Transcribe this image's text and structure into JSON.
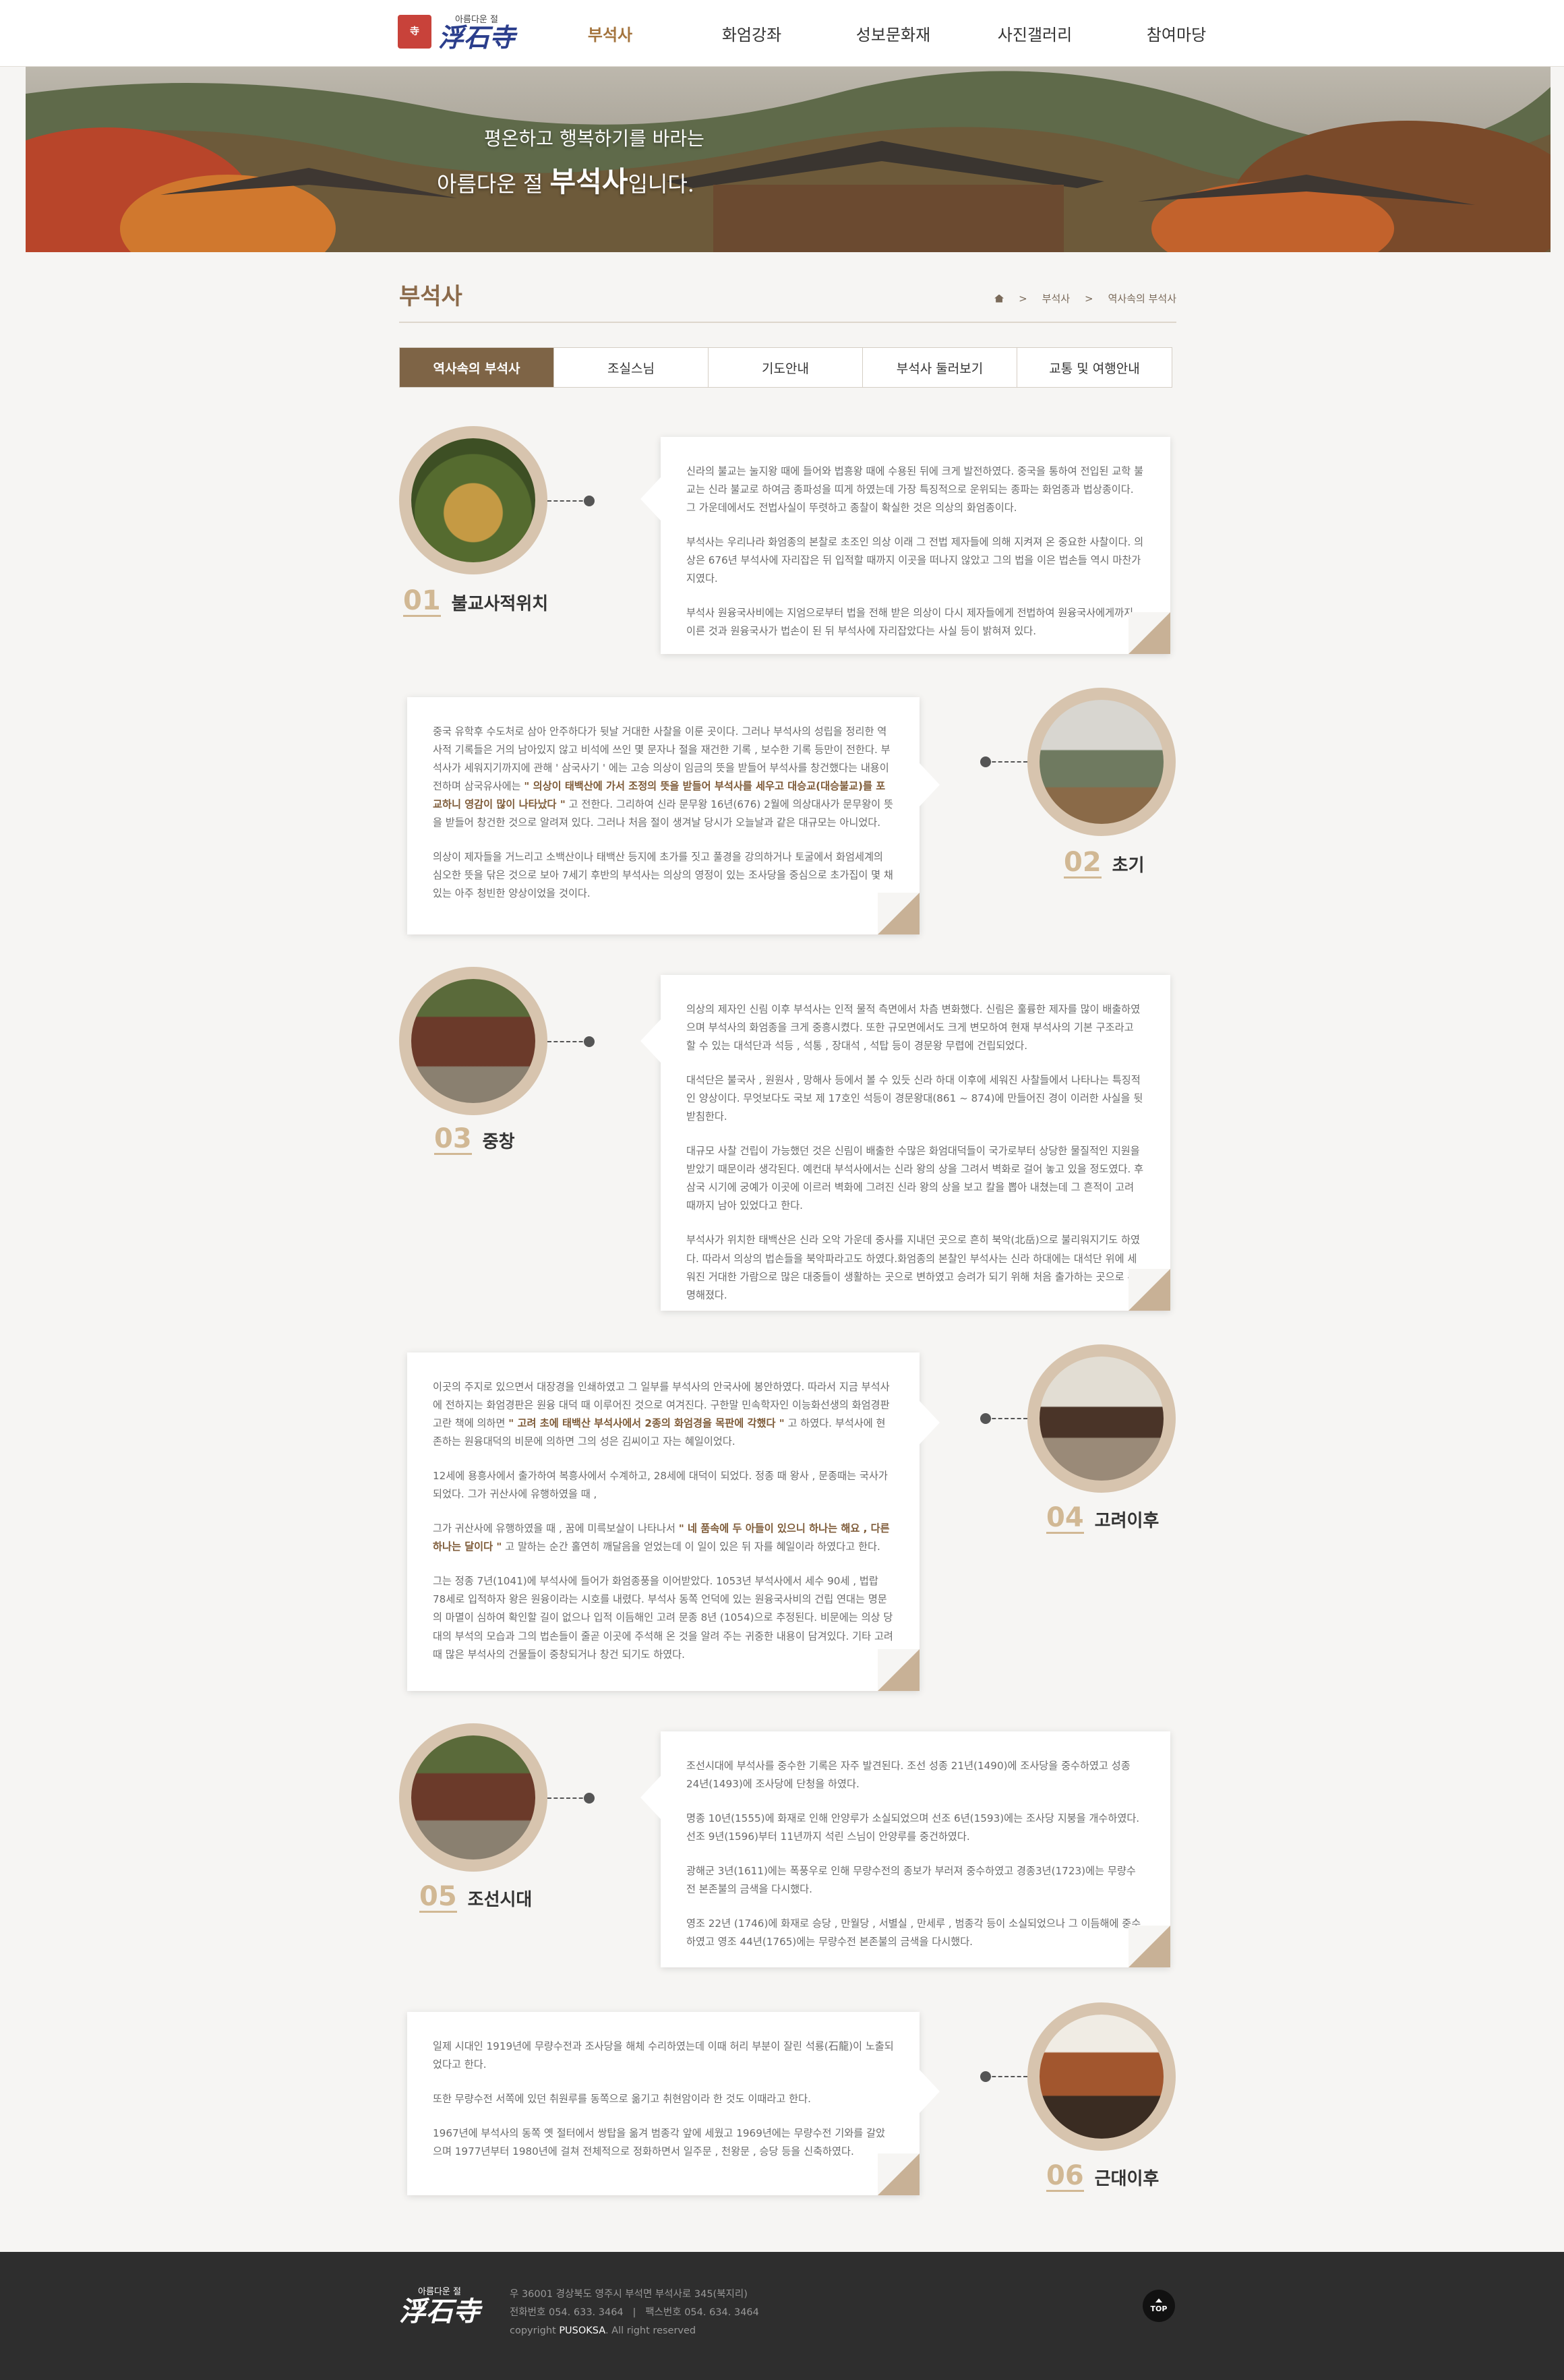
{
  "header": {
    "logo_small": "아름다운 절",
    "logo_big": "浮石寺",
    "nav": [
      {
        "label": "부석사",
        "active": true
      },
      {
        "label": "화엄강좌",
        "active": false
      },
      {
        "label": "성보문화재",
        "active": false
      },
      {
        "label": "사진갤러리",
        "active": false
      },
      {
        "label": "참여마당",
        "active": false
      }
    ]
  },
  "banner": {
    "line1": "평온하고 행복하기를 바라는",
    "line2_prefix": "아름다운 절",
    "line2_strong": "부석사",
    "line2_suffix": "입니다."
  },
  "page": {
    "title": "부석사",
    "breadcrumb": [
      "부석사",
      "역사속의 부석사"
    ]
  },
  "tabs": [
    {
      "label": "역사속의 부석사",
      "active": true
    },
    {
      "label": "조실스님",
      "active": false
    },
    {
      "label": "기도안내",
      "active": false
    },
    {
      "label": "부석사 둘러보기",
      "active": false
    },
    {
      "label": "교통 및 여행안내",
      "active": false
    }
  ],
  "history": [
    {
      "num": "01",
      "title": "불교사적위치",
      "paragraphs": [
        "신라의 불교는 눌지왕 때에 들어와 법흥왕 때에 수용된 뒤에 크게 발전하였다. 중국을 통하여 전입된 교학 불교는 신라 불교로 하여금 종파성을 띠게 하였는데 가장 특징적으로 운위되는 종파는 화엄종과 법상종이다. 그 가운데에서도 전법사실이 뚜렷하고 종찰이 확실한 것은 의상의 화엄종이다.",
        "부석사는 우리나라 화엄종의 본찰로 초조인 의상 이래 그 전법 제자들에 의해 지켜져 온 중요한 사찰이다. 의상은 676년 부석사에 자리잡은 뒤 입적할 때까지 이곳을 떠나지 않았고 그의 법을 이은 법손들 역시 마찬가지였다.",
        "부석사 원융국사비에는 지엄으로부터 법을 전해 받은 의상이 다시 제자들에게 전법하여 원융국사에게까지 이른 것과 원융국사가 법손이 된 뒤 부석사에 자리잡았다는 사실 등이 밝혀져 있다."
      ]
    },
    {
      "num": "02",
      "title": "초기",
      "paragraphs": [
        "중국 유학후 수도처로 삼아 안주하다가 뒷날 거대한 사찰을 이룬 곳이다. 그러나 부석사의 성립을 정리한 역사적 기록들은 거의 남아있지 않고 비석에 쓰인 몇 문자나 절을 재건한 기록 , 보수한 기록 등만이 전한다. 부석사가 세워지기까지에 관해 ' 삼국사기 ' 에는 고승 의상이 임금의 뜻을 받들어 부석사를 창건했다는 내용이 전하며 삼국유사에는",
        "의상이 제자들을 거느리고 소백산이나 태백산 등지에 초가를 짓고 풀경을 강의하거나 토굴에서 화엄세계의 심오한 뜻을 닦은 것으로 보아 7세기 후반의 부석사는 의상의 영정이 있는 조사당을 중심으로 초가집이 몇 채 있는 아주 청빈한 양상이었을 것이다."
      ],
      "emph": "\" 의상이 태백산에 가서 조정의 뜻을 받들어 부석사를 세우고 대승교(대승불교)를 포교하니 영감이 많이 나타났다 \"",
      "emph_after": " 고 전한다. 그리하여 신라 문무왕 16년(676) 2월에 의상대사가 문무왕이 뜻을 받들어 창건한 것으로 알려져 있다. 그러나 처음 절이 생겨날 당시가 오늘날과 같은 대규모는 아니었다."
    },
    {
      "num": "03",
      "title": "중창",
      "paragraphs": [
        "의상의 제자인 신림 이후 부석사는 인적 물적 측면에서 차츰 변화했다. 신림은 훌륭한 제자를 많이 배출하였으며 부석사의 화엄종을 크게 중흥시켰다. 또한 규모면에서도 크게 변모하여 현재 부석사의 기본 구조라고 할 수 있는 대석단과 석등 , 석통 , 장대석 , 석탑 등이 경문왕 무렵에 건립되었다.",
        "대석단은 불국사 , 원원사 , 망해사 등에서 볼 수 있듯 신라 하대 이후에 세워진 사찰들에서 나타나는 특징적인 양상이다. 무엇보다도 국보 제 17호인 석등이 경문왕대(861 ~ 874)에 만들어진 경이 이러한 사실을 뒷받침한다.",
        "대규모 사찰 건립이 가능했던 것은 신림이 배출한 수많은 화엄대덕들이 국가로부터 상당한 물질적인 지원을 받았기 때문이라 생각된다. 예컨대 부석사에서는 신라 왕의 상을 그려서 벽화로 걸어 놓고 있을 정도였다. 후삼국 시기에 궁예가 이곳에 이르러 벽화에 그려진 신라 왕의 상을 보고 칼을 뽑아 내쳤는데 그 흔적이 고려 때까지 남아 있었다고 한다.",
        "부석사가 위치한 태백산은 신라 오악 가운데 중사를 지내던 곳으로 흔히 북악(北岳)으로 불리워지기도 하였다. 따라서 의상의 법손들을 북악파라고도 하였다.화엄종의 본찰인 부석사는 신라 하대에는 대석단 위에 세워진 거대한 가람으로 많은 대중들이 생활하는 곳으로 변하였고 승려가 되기 위해 처음 출가하는 곳으로 유명해졌다."
      ]
    },
    {
      "num": "04",
      "title": "고려이후",
      "p1_before": "이곳의 주지로 있으면서 대장경을 인쇄하였고 그 일부를 부석사의 안국사에 봉안하였다. 따라서 지금 부석사에 전하지는 화엄경판은 원융 대덕 때 이루어진 것으로 여겨진다. 구한말 민속학자인 이능화선생의 화엄경판고란 책에 의하면 ",
      "p1_emph": "\" 고려 초에 태백산 부석사에서 2종의 화엄경을 목판에 각했다 \"",
      "p1_after": " 고 하였다. 부석사에 현존하는 원융대덕의 비문에 의하면 그의 성은 김씨이고 자는 혜일이었다.",
      "p2": "12세에 용흥사에서 출가하여 복흥사에서 수계하고, 28세에 대덕이 되었다. 정종 때 왕사 , 문종때는 국사가 되었다. 그가 귀산사에 유행하였을 때 ,",
      "p3_before": "그가 귀산사에 유행하였을 때 , 꿈에 미륵보살이 나타나서 ",
      "p3_emph": "\" 네 품속에 두 아들이 있으니 하나는 해요 , 다른 하나는 달이다 \"",
      "p3_after": " 고 말하는 순간 홀연히 깨달음을 얻었는데 이 일이 있은 뒤 자를 혜일이라 하였다고 한다.",
      "p4": "그는 정종 7년(1041)에 부석사에 들어가 화엄종풍을 이어받았다. 1053년 부석사에서 세수 90세 , 법랍 78세로 입적하자 왕은 원융이라는 시호를 내렸다. 부석사 동쪽 언덕에 있는 원융국사비의 건립 연대는 명문의 마멸이 심하여 확인할 길이 없으나 입적 이듬해인 고려 문종 8년 (1054)으로 추정된다. 비문에는 의상 당대의 부석의 모습과 그의 법손들이 줄곧 이곳에 주석해 온 것을 알려 주는 귀중한 내용이 담겨있다. 기타 고려 때 많은 부석사의 건물들이 중창되거나 창건 되기도 하였다."
    },
    {
      "num": "05",
      "title": "조선시대",
      "paragraphs": [
        "조선시대에 부석사를 중수한 기록은 자주 발견된다. 조선 성종 21년(1490)에 조사당을 중수하였고 성종 24년(1493)에 조사당에 단청을 하였다.",
        "명종 10년(1555)에 화재로 인해 안양루가 소실되었으며 선조 6년(1593)에는 조사당 지붕을 개수하였다. 선조 9년(1596)부터 11년까지 석린 스님이 안양루를 중건하였다.",
        "광해군 3년(1611)에는 폭풍우로 인해 무량수전의 종보가 부러져 중수하였고 경종3년(1723)에는 무량수전 본존불의 금색을 다시했다.",
        "영조 22년 (1746)에 화재로 승당 , 만월당 , 서별실 , 만세루 , 범종각 등이 소실되었으나 그 이듬해에 중수하였고 영조 44년(1765)에는 무량수전 본존불의 금색을 다시했다."
      ]
    },
    {
      "num": "06",
      "title": "근대이후",
      "paragraphs": [
        "일제 시대인 1919년에 무량수전과 조사당을 해체 수리하였는데 이때 허리 부분이 잘린 석룡(石龍)이 노출되었다고 한다.",
        "또한 무량수전 서쪽에 있던 취원루를 동쪽으로 옮기고 취현암이라 한 것도 이때라고 한다.",
        "1967년에 부석사의 동쪽 옛 절터에서 쌍탑을 옮겨 범종각 앞에 세웠고 1969년에는 무량수전 기와를 갈았으며 1977년부터 1980년에 걸쳐 전체적으로 정화하면서 일주문 , 천왕문 , 승당 등을 신축하였다."
      ]
    }
  ],
  "footer": {
    "logo_small": "아름다운 절",
    "logo_big": "浮石寺",
    "address": "우 36001 경상북도 영주시 부석면 부석사로 345(북지리)",
    "phone": "전화번호 054. 633. 3464",
    "separator": "|",
    "fax": "팩스번호 054. 634. 3464",
    "copyright_prefix": "copyright",
    "copyright_brand": "PUSOKSA",
    "copyright_suffix": ". All right reserved",
    "top_label": "TOP"
  },
  "colors": {
    "accent": "#7e6446",
    "label_num": "#d1b894",
    "circle_ring": "#d7c4ae",
    "footer_bg": "#2e2e2e",
    "logo_seal": "#c8423a"
  }
}
